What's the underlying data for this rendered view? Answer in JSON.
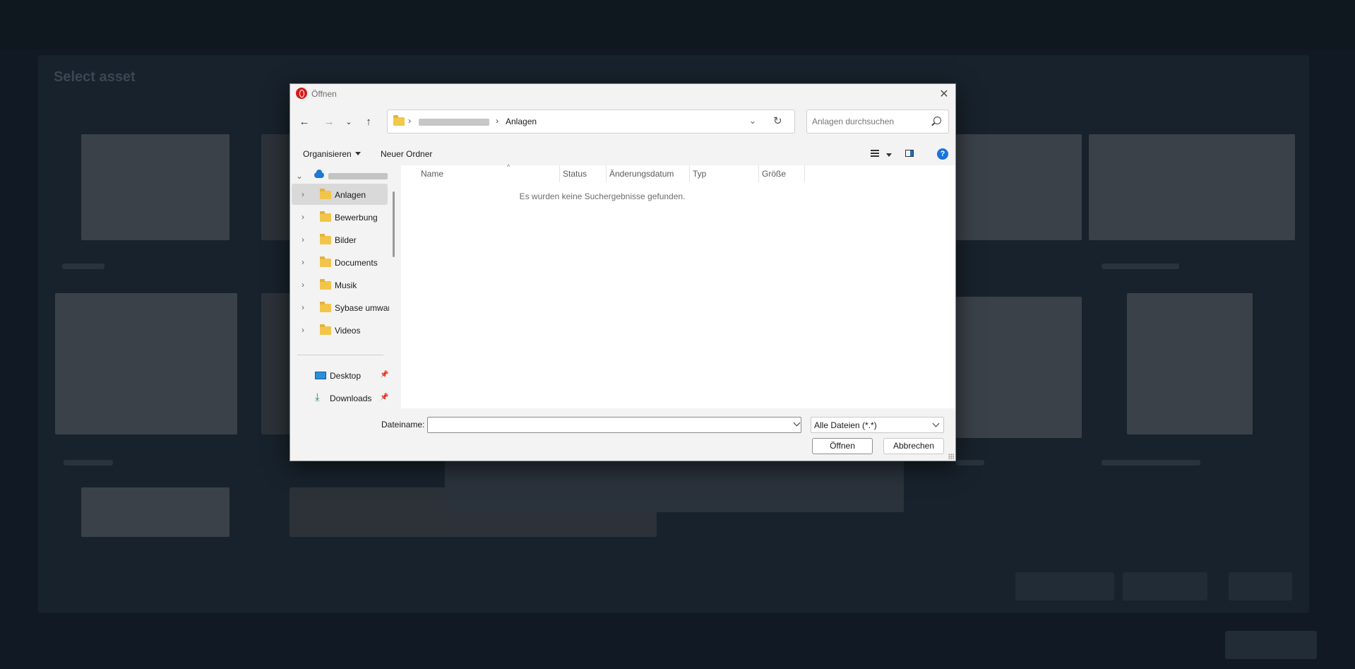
{
  "background_app": {
    "title": "Select asset"
  },
  "dialog": {
    "title": "Öffnen",
    "address": {
      "current_folder": "Anlagen",
      "separator": "›"
    },
    "search": {
      "placeholder": "Anlagen durchsuchen"
    },
    "toolbar": {
      "organize_label": "Organisieren",
      "new_folder_label": "Neuer Ordner",
      "help_glyph": "?"
    },
    "nav_pane": {
      "folders": [
        {
          "label": "Anlagen",
          "selected": true
        },
        {
          "label": "Bewerbung",
          "selected": false
        },
        {
          "label": "Bilder",
          "selected": false
        },
        {
          "label": "Documents",
          "selected": false
        },
        {
          "label": "Musik",
          "selected": false
        },
        {
          "label": "Sybase umwar",
          "selected": false
        },
        {
          "label": "Videos",
          "selected": false
        }
      ],
      "quick_access": [
        {
          "label": "Desktop",
          "icon": "desktop-icon"
        },
        {
          "label": "Downloads",
          "icon": "download-icon"
        }
      ]
    },
    "columns": [
      "Name",
      "Status",
      "Änderungsdatum",
      "Typ",
      "Größe"
    ],
    "empty_message": "Es wurden keine Suchergebnisse gefunden.",
    "file_name": {
      "label": "Dateiname:",
      "value": ""
    },
    "file_type": {
      "selected": "Alle Dateien (*.*)"
    },
    "buttons": {
      "open": "Öffnen",
      "cancel": "Abbrechen"
    },
    "colors": {
      "accent": "#1a73d9",
      "folder": "#f2c54a",
      "app_icon": "#d81a1a"
    }
  }
}
